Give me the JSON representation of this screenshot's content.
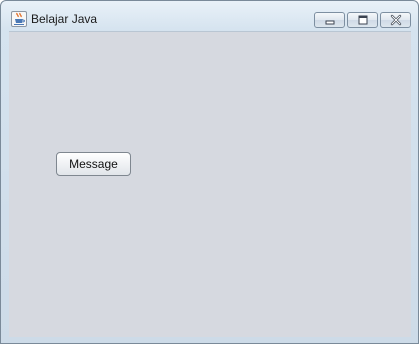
{
  "window": {
    "title": "Belajar Java",
    "app_icon": "java-coffee-cup-icon",
    "controls": {
      "minimize_icon": "minimize-icon",
      "maximize_icon": "maximize-icon",
      "close_icon": "close-icon"
    }
  },
  "content": {
    "message_button_label": "Message"
  },
  "colors": {
    "client_background": "#d6d9e0",
    "titlebar": "#d5e3ef",
    "button_border": "#7f8790"
  }
}
